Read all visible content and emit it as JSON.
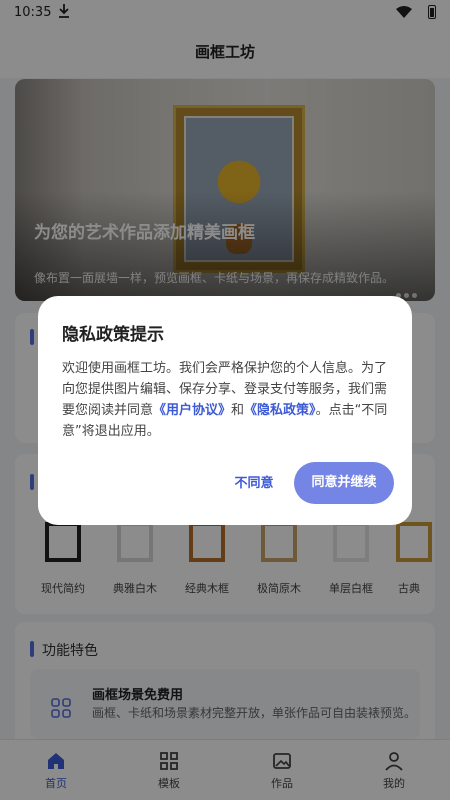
{
  "status": {
    "time": "10:35"
  },
  "header": {
    "title": "画框工坊"
  },
  "hero": {
    "title": "为您的艺术作品添加精美画框",
    "subtitle": "像布置一面展墙一样，预览画框、卡纸与场景，再保存成精致作品。"
  },
  "frames": {
    "items": [
      {
        "label": "现代简约",
        "color": "#222222"
      },
      {
        "label": "典雅白木",
        "color": "#d8d8d8"
      },
      {
        "label": "经典木框",
        "color": "#b5702f"
      },
      {
        "label": "极简原木",
        "color": "#c9a36c"
      },
      {
        "label": "单层白框",
        "color": "#e6e6e6"
      },
      {
        "label": "古典",
        "color": "#c99a3a"
      }
    ]
  },
  "features": {
    "section_title": "功能特色",
    "items": [
      {
        "title": "画框场景免费用",
        "desc": "画框、卡纸和场景素材完整开放，单张作品可自由装裱预览。",
        "icon": "grid-icon"
      }
    ]
  },
  "nav": {
    "items": [
      {
        "label": "首页",
        "icon": "home-icon",
        "active": true
      },
      {
        "label": "模板",
        "icon": "grid-icon",
        "active": false
      },
      {
        "label": "作品",
        "icon": "image-icon",
        "active": false
      },
      {
        "label": "我的",
        "icon": "user-icon",
        "active": false
      }
    ]
  },
  "dialog": {
    "title": "隐私政策提示",
    "body_1": "欢迎使用画框工坊。我们会严格保护您的个人信息。为了向您提供图片编辑、保存分享、登录支付等服务，我们需要您阅读并同意",
    "link_terms": "《用户协议》",
    "and": "和",
    "link_privacy": "《隐私政策》",
    "body_2": "。点击“不同意”将退出应用。",
    "decline": "不同意",
    "accept": "同意并继续"
  },
  "colors": {
    "accent": "#5a6de0",
    "primary_button": "#7585e6",
    "link": "#3d5ad6"
  }
}
